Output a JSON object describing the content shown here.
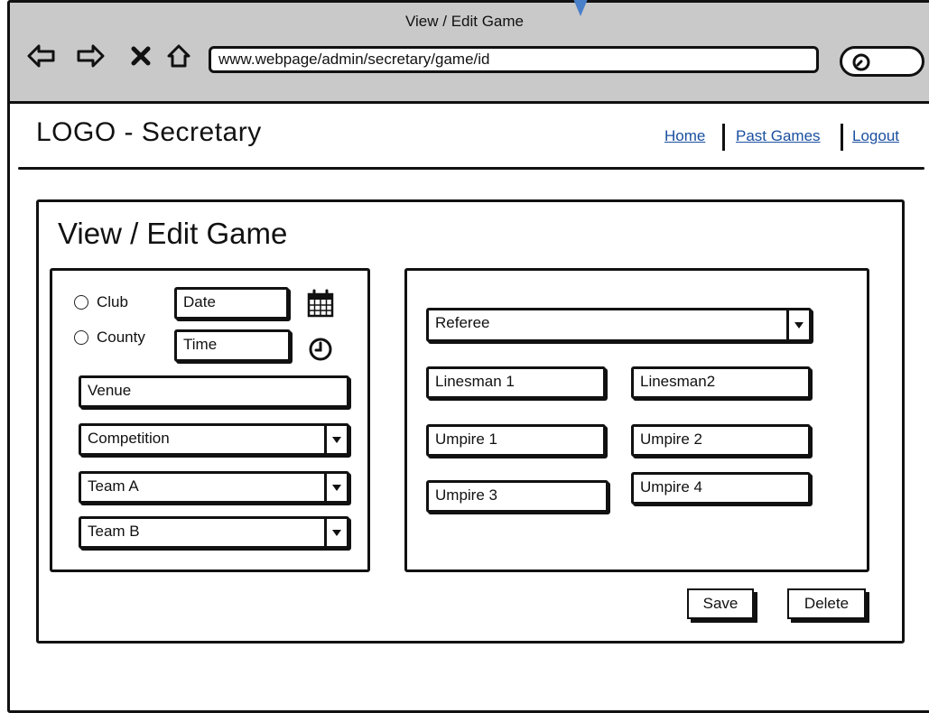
{
  "browser": {
    "window_title": "View / Edit Game",
    "url": "www.webpage/admin/secretary/game/id"
  },
  "header": {
    "logo": "LOGO - Secretary",
    "nav": {
      "home": "Home",
      "past_games": "Past Games",
      "logout": "Logout"
    }
  },
  "card": {
    "title": "View / Edit Game"
  },
  "game_details": {
    "type_options": {
      "club": "Club",
      "county": "County"
    },
    "date_placeholder": "Date",
    "time_placeholder": "Time",
    "venue_placeholder": "Venue",
    "competition_label": "Competition",
    "team_a_label": "Team A",
    "team_b_label": "Team B"
  },
  "officials": {
    "referee_label": "Referee",
    "linesman1": "Linesman 1",
    "linesman2": "Linesman2",
    "umpire1": "Umpire 1",
    "umpire2": "Umpire 2",
    "umpire3": "Umpire 3",
    "umpire4": "Umpire 4"
  },
  "actions": {
    "save": "Save",
    "delete": "Delete"
  },
  "icons": {
    "back": "back-arrow-icon",
    "forward": "forward-arrow-icon",
    "stop": "close-icon",
    "home": "home-icon",
    "search": "search-icon",
    "calendar": "calendar-icon",
    "clock": "clock-icon"
  },
  "colors": {
    "browser_bar": "#c9c9c9",
    "link": "#1a4fa0",
    "cursor_pin": "#4a7fc9"
  }
}
